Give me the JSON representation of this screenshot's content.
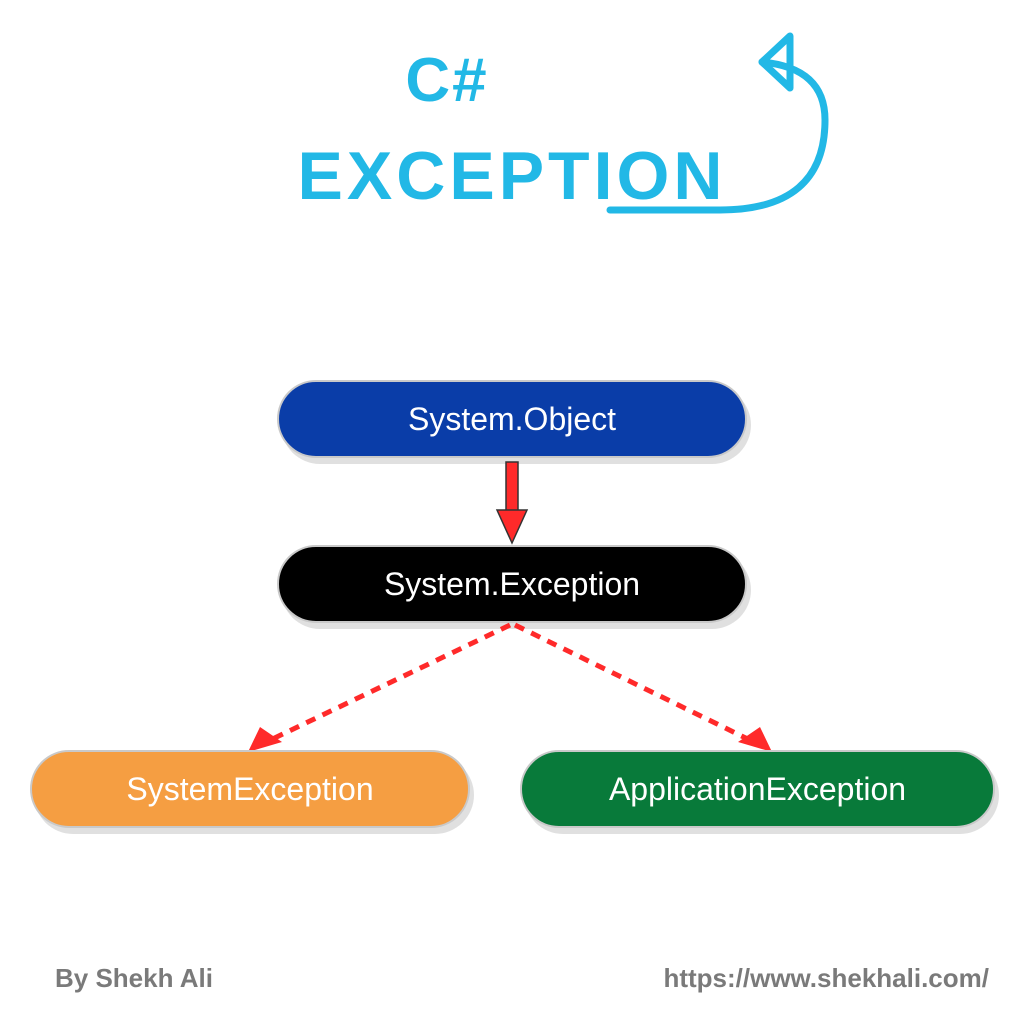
{
  "title": {
    "line1": "C#",
    "line2": "EXCEPTION"
  },
  "nodes": {
    "object": "System.Object",
    "exception": "System.Exception",
    "systemException": "SystemException",
    "applicationException": "ApplicationException"
  },
  "footer": {
    "author": "By Shekh Ali",
    "url": "https://www.shekhali.com/"
  },
  "diagram": {
    "type": "hierarchy",
    "root": "System.Object",
    "edges": [
      {
        "from": "System.Object",
        "to": "System.Exception",
        "style": "solid"
      },
      {
        "from": "System.Exception",
        "to": "SystemException",
        "style": "dashed"
      },
      {
        "from": "System.Exception",
        "to": "ApplicationException",
        "style": "dashed"
      }
    ]
  },
  "colors": {
    "titleAccent": "#22b8e6",
    "nodeObject": "#0a3da8",
    "nodeException": "#000000",
    "nodeSystem": "#f59e42",
    "nodeApplication": "#087a3a",
    "arrowRed": "#ff2a2a",
    "footerGrey": "#7a7a7a"
  }
}
